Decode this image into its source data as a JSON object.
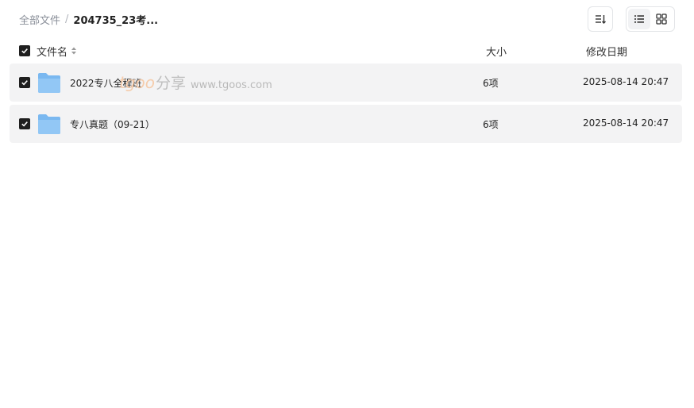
{
  "breadcrumb": {
    "root": "全部文件",
    "separator": "/",
    "current": "204735_23考..."
  },
  "toolbar": {
    "sort_icon": "sort-icon",
    "list_view_icon": "list-view-icon",
    "grid_view_icon": "grid-view-icon",
    "active_view": "list"
  },
  "table": {
    "headers": {
      "name": "文件名",
      "size": "大小",
      "date": "修改日期"
    },
    "rows": [
      {
        "name": "2022专八全程班",
        "size": "6项",
        "date": "2025-08-14 20:47",
        "checked": true,
        "icon": "folder-icon"
      },
      {
        "name": "专八真题（09-21）",
        "size": "6项",
        "date": "2025-08-14 20:47",
        "checked": true,
        "icon": "folder-icon"
      }
    ]
  },
  "watermark": {
    "brand": "tgoo",
    "share": "分享",
    "url": "www.tgoos.com"
  },
  "colors": {
    "row_background": "#f3f3f4",
    "checkbox": "#1f1f1f",
    "folder": "#7ab8f0",
    "muted_text": "#8a8f99"
  }
}
